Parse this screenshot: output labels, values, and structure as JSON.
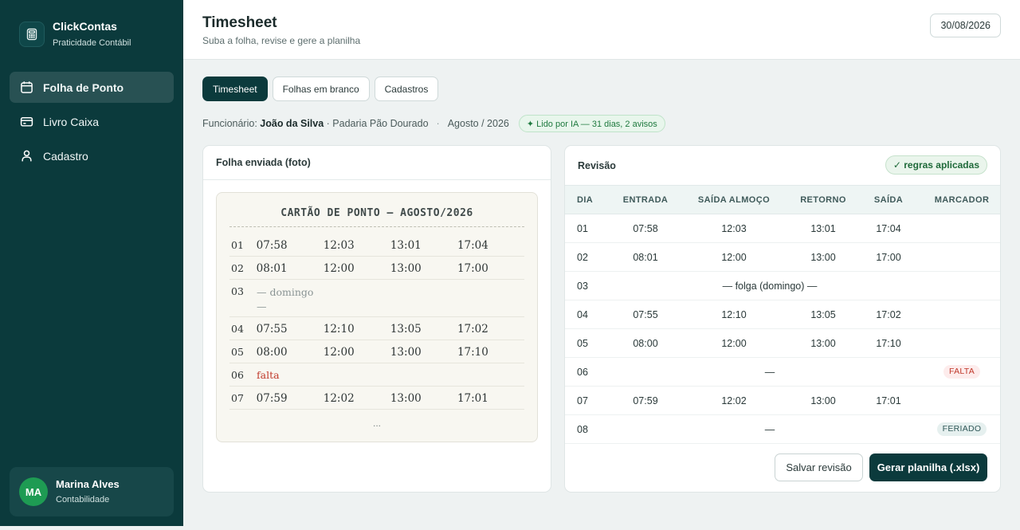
{
  "colors": {
    "sidebar": "#0b3a3c",
    "accent": "#0b3a3c",
    "avatar": "#1e9b53",
    "danger": "#c0392b",
    "success": "#1f7a3f"
  },
  "brand": {
    "name": "ClickContas",
    "subtitle": "Praticidade Contábil",
    "icon": "calculator-icon"
  },
  "nav": [
    {
      "label": "Folha de Ponto",
      "icon": "calendar-icon",
      "active": true
    },
    {
      "label": "Livro Caixa",
      "icon": "credit-card-icon",
      "active": false
    },
    {
      "label": "Cadastro",
      "icon": "user-icon",
      "active": false
    }
  ],
  "user": {
    "initials": "MA",
    "name": "Marina Alves",
    "role": "Contabilidade"
  },
  "header": {
    "title": "Timesheet",
    "subtitle": "Suba a folha, revise e gere a planilha",
    "date": "30/08/2026"
  },
  "tabs": [
    {
      "label": "Timesheet",
      "active": true
    },
    {
      "label": "Folhas em branco",
      "active": false
    },
    {
      "label": "Cadastros",
      "active": false
    }
  ],
  "meta": {
    "employee_label": "Funcionário:",
    "employee_name": "João da Silva",
    "company": "· Padaria Pão Dourado",
    "separator": "·",
    "period": "Agosto / 2026",
    "ai_badge": "✦ Lido por IA — 31 dias, 2 avisos"
  },
  "left_panel": {
    "title": "Folha enviada (foto)",
    "card_title": "CARTÃO DE PONTO — AGOSTO/2026",
    "rows": [
      {
        "day": "01",
        "times": [
          "07:58",
          "12:03",
          "13:01",
          "17:04"
        ]
      },
      {
        "day": "02",
        "times": [
          "08:01",
          "12:00",
          "13:00",
          "17:00"
        ]
      },
      {
        "day": "03",
        "note": "— domingo —"
      },
      {
        "day": "04",
        "times": [
          "07:55",
          "12:10",
          "13:05",
          "17:02"
        ]
      },
      {
        "day": "05",
        "times": [
          "08:00",
          "12:00",
          "13:00",
          "17:10"
        ]
      },
      {
        "day": "06",
        "falta": "falta"
      },
      {
        "day": "07",
        "times": [
          "07:59",
          "12:02",
          "13:00",
          "17:01"
        ]
      }
    ],
    "more": "..."
  },
  "right_panel": {
    "title": "Revisão",
    "rules_badge": "✓ regras aplicadas",
    "columns": [
      "DIA",
      "ENTRADA",
      "SAÍDA ALMOÇO",
      "RETORNO",
      "SAÍDA",
      "MARCADOR"
    ],
    "rows": [
      {
        "dia": "01",
        "entrada": "07:58",
        "saida_almoco": "12:03",
        "retorno": "13:01",
        "saida": "17:04",
        "marcador": ""
      },
      {
        "dia": "02",
        "entrada": "08:01",
        "saida_almoco": "12:00",
        "retorno": "13:00",
        "saida": "17:00",
        "marcador": ""
      },
      {
        "dia": "03",
        "span": "— folga (domingo) —"
      },
      {
        "dia": "04",
        "entrada": "07:55",
        "saida_almoco": "12:10",
        "retorno": "13:05",
        "saida": "17:02",
        "marcador": ""
      },
      {
        "dia": "05",
        "entrada": "08:00",
        "saida_almoco": "12:00",
        "retorno": "13:00",
        "saida": "17:10",
        "marcador": ""
      },
      {
        "dia": "06",
        "span": "—",
        "marcador": "FALTA"
      },
      {
        "dia": "07",
        "entrada": "07:59",
        "saida_almoco": "12:02",
        "retorno": "13:00",
        "saida": "17:01",
        "marcador": ""
      },
      {
        "dia": "08",
        "span": "—",
        "marcador": "FERIADO"
      }
    ],
    "save_button": "Salvar revisão",
    "generate_button": "Gerar planilha (.xlsx)"
  }
}
